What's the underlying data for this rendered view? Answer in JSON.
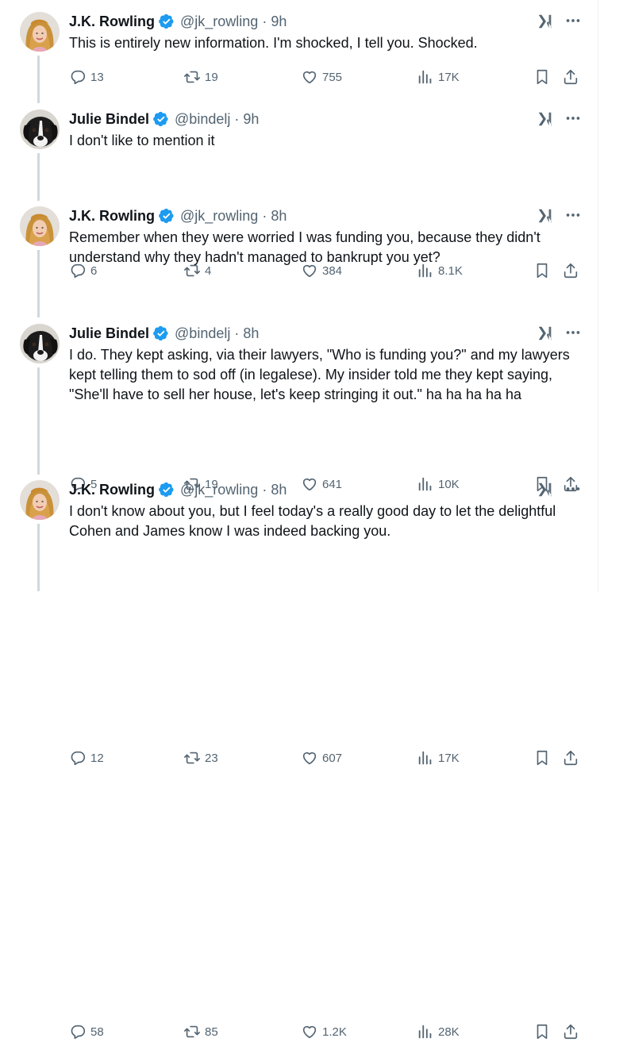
{
  "tweets": [
    {
      "name": "J.K. Rowling",
      "handle": "@jk_rowling",
      "time": "· 9h",
      "avatar": "jk",
      "text": "This is entirely new information. I'm shocked, I tell you. Shocked.",
      "replies": "13",
      "retweets": "19",
      "likes": "755",
      "views": "17K"
    },
    {
      "name": "Julie Bindel",
      "handle": "@bindelj",
      "time": "· 9h",
      "avatar": "jb",
      "text": "I don't like to mention it",
      "replies": "6",
      "retweets": "4",
      "likes": "384",
      "views": "8.1K"
    },
    {
      "name": "J.K. Rowling",
      "handle": "@jk_rowling",
      "time": "· 8h",
      "avatar": "jk",
      "text": "Remember when they were worried I was funding you, because they didn't understand why they hadn't managed to bankrupt you yet?",
      "replies": "5",
      "retweets": "19",
      "likes": "641",
      "views": "10K"
    },
    {
      "name": "Julie Bindel",
      "handle": "@bindelj",
      "time": "· 8h",
      "avatar": "jb",
      "text": "I do. They kept asking, via their lawyers, \"Who is funding you?\" and my lawyers kept telling them to sod off (in legalese). My insider told me they kept saying, \"She'll have to sell her house, let's keep stringing it out.\" ha ha ha ha ha",
      "replies": "12",
      "retweets": "23",
      "likes": "607",
      "views": "17K"
    },
    {
      "name": "J.K. Rowling",
      "handle": "@jk_rowling",
      "time": "· 8h",
      "avatar": "jk",
      "text": "I don't know about you, but I feel today's a really good day to let the delightful Cohen and James know I was indeed backing you.",
      "replies": "58",
      "retweets": "85",
      "likes": "1.2K",
      "views": "28K"
    }
  ],
  "colors": {
    "verified": "#1d9bf0",
    "muted": "#536471",
    "text": "#0f1419",
    "thread_line": "#cfd9de"
  }
}
